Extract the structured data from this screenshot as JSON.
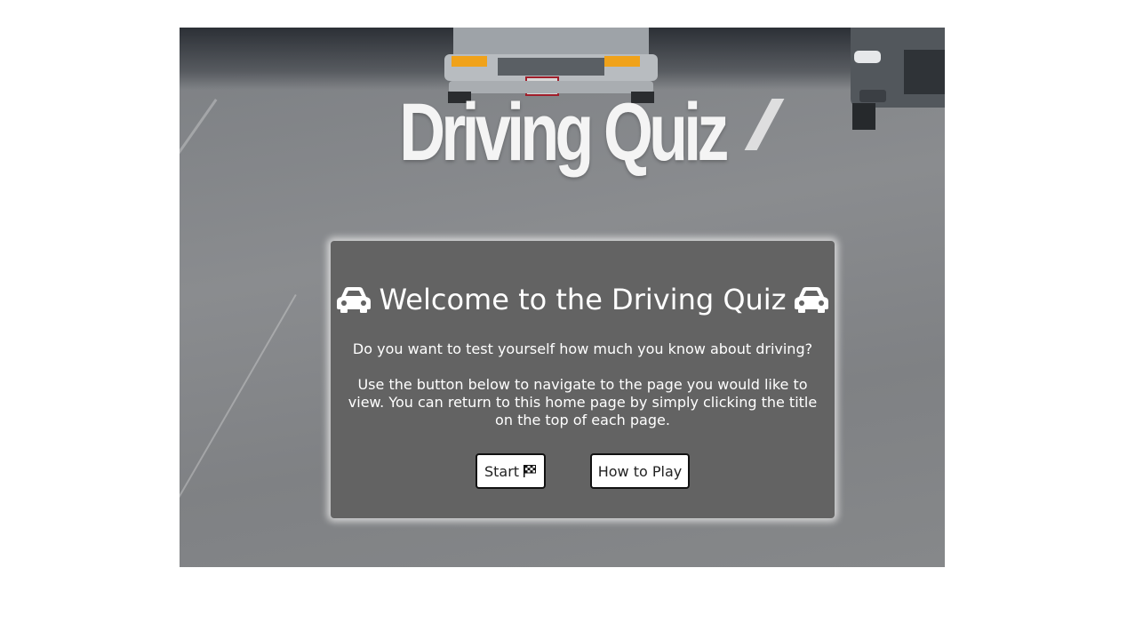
{
  "header": {
    "title": "Driving Quiz"
  },
  "welcome": {
    "heading": "Welcome to the Driving Quiz",
    "icon_left": "car-icon",
    "icon_right": "car-icon",
    "question": "Do you want to test yourself how much you know about driving?",
    "instructions": "Use the button below to navigate to the page you would like to view. You can return to this home page by simply clicking the title on the top of each page."
  },
  "buttons": {
    "start_label": "Start",
    "start_icon": "checkered-flag-icon",
    "howto_label": "How to Play"
  },
  "colors": {
    "card_background": "#636363",
    "title_text": "#f4f4f4",
    "button_background": "#ffffff",
    "button_border": "#111111"
  }
}
